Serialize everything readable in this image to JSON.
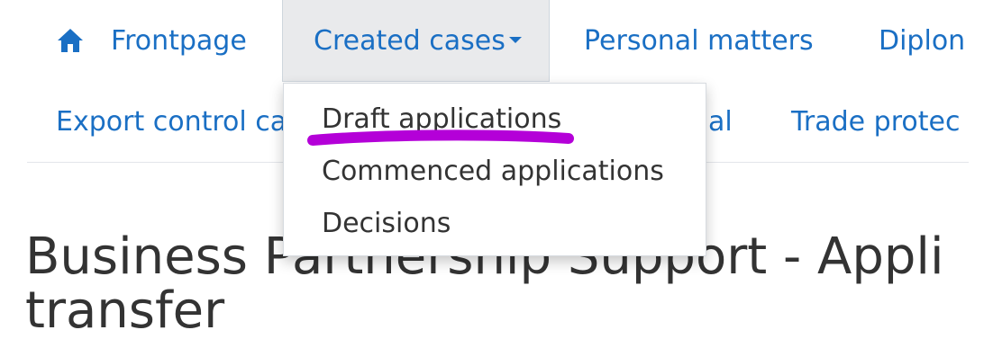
{
  "nav": {
    "row1": {
      "frontpage_label": "Frontpage",
      "created_cases_label": "Created cases",
      "personal_matters_label": "Personal matters",
      "diplomacy_label": "Diplon"
    },
    "row2": {
      "export_control_label": "Export control ca",
      "partial_al_label": "al",
      "trade_protection_label": "Trade protec"
    }
  },
  "dropdown": {
    "items": [
      {
        "label": "Draft applications"
      },
      {
        "label": "Commenced applications"
      },
      {
        "label": "Decisions"
      }
    ]
  },
  "page": {
    "heading_line1": "Business Partnership Support - Appli",
    "heading_line2": "transfer"
  },
  "colors": {
    "link": "#1a6fc4",
    "highlight_marker": "#b400d8",
    "active_tab_bg": "#e9eaec",
    "text": "#333333"
  },
  "icons": {
    "home": "home-icon",
    "caret": "caret-down-icon"
  }
}
